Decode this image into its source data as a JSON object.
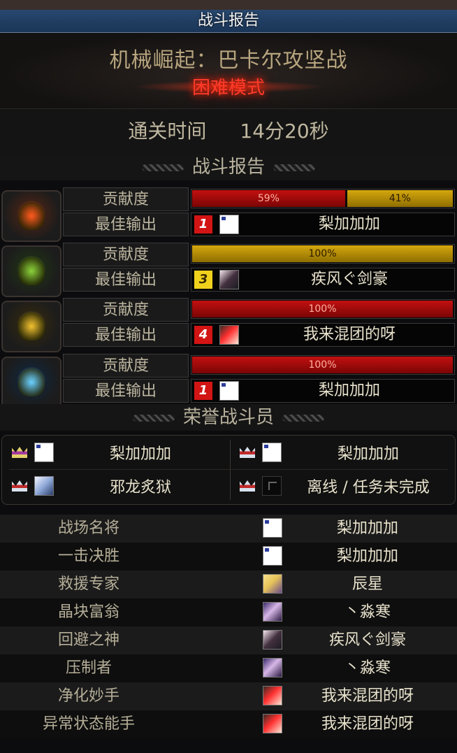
{
  "window": {
    "title": "战斗报告"
  },
  "dungeon": {
    "name": "机械崛起：巴卡尔攻坚战",
    "mode": "困难模式"
  },
  "clear": {
    "label": "通关时间",
    "time": "14分20秒"
  },
  "report": {
    "section_title": "战斗报告",
    "contribution_label": "贡献度",
    "best_damage_label": "最佳输出",
    "classes": [
      {
        "icon": "red-mechanical-crest-icon",
        "segments": [
          {
            "pct": 59,
            "text": "59%",
            "color": "red"
          },
          {
            "pct": 41,
            "text": "41%",
            "color": "gold"
          }
        ],
        "best": {
          "rank": "1",
          "rank_color": "red",
          "avatar": "white",
          "name": "梨加加加"
        }
      },
      {
        "icon": "green-mechanical-crest-icon",
        "segments": [
          {
            "pct": 100,
            "text": "100%",
            "color": "gold"
          }
        ],
        "best": {
          "rank": "3",
          "rank_color": "yellow",
          "avatar": "dark",
          "name": "疾风ぐ剑豪"
        }
      },
      {
        "icon": "gold-mechanical-crest-icon",
        "segments": [
          {
            "pct": 100,
            "text": "100%",
            "color": "red"
          }
        ],
        "best": {
          "rank": "4",
          "rank_color": "red",
          "avatar": "red",
          "name": "我来混团的呀"
        }
      },
      {
        "icon": "blue-mechanical-crest-icon",
        "segments": [
          {
            "pct": 100,
            "text": "100%",
            "color": "red"
          }
        ],
        "best": {
          "rank": "1",
          "rank_color": "red",
          "avatar": "white",
          "name": "梨加加加"
        }
      }
    ]
  },
  "honor": {
    "section_title": "荣誉战斗员",
    "members": [
      {
        "crown": "gold",
        "avatar": "white",
        "name": "梨加加加"
      },
      {
        "crown": "silver",
        "avatar": "white",
        "name": "梨加加加"
      },
      {
        "crown": "silver",
        "avatar": "silver",
        "name": "邪龙炙狱"
      },
      {
        "crown": "silver",
        "avatar": "black",
        "name": "离线 / 任务未完成"
      }
    ]
  },
  "awards": [
    {
      "title": "战场名将",
      "avatar": "white",
      "name": "梨加加加"
    },
    {
      "title": "一击决胜",
      "avatar": "white",
      "name": "梨加加加"
    },
    {
      "title": "救援专家",
      "avatar": "blonde",
      "name": "辰星"
    },
    {
      "title": "晶块富翁",
      "avatar": "purple",
      "name": "丶淼寒"
    },
    {
      "title": "回避之神",
      "avatar": "dark",
      "name": "疾风ぐ剑豪"
    },
    {
      "title": "压制者",
      "avatar": "purple",
      "name": "丶淼寒"
    },
    {
      "title": "净化妙手",
      "avatar": "red",
      "name": "我来混团的呀"
    },
    {
      "title": "异常状态能手",
      "avatar": "red",
      "name": "我来混团的呀"
    }
  ]
}
